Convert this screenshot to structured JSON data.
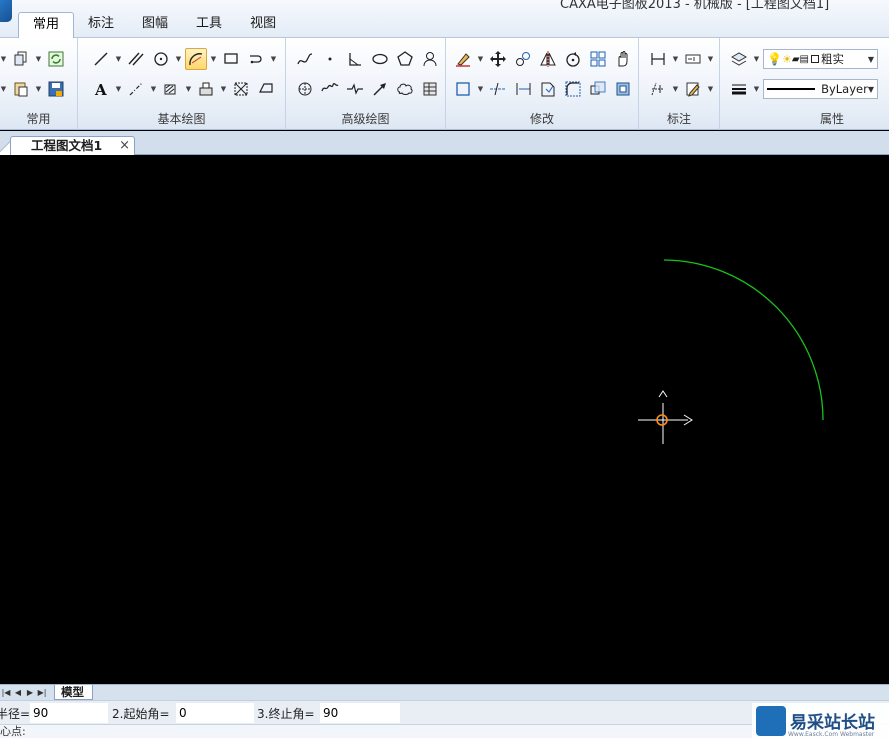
{
  "window": {
    "title": "CAXA电子图板2013 - 机械版 - [工程图文档1]"
  },
  "ribbon_tabs": [
    {
      "label": "常用",
      "active": true
    },
    {
      "label": "标注",
      "active": false
    },
    {
      "label": "图幅",
      "active": false
    },
    {
      "label": "工具",
      "active": false
    },
    {
      "label": "视图",
      "active": false
    }
  ],
  "groups": {
    "common": "常用",
    "basic_draw": "基本绘图",
    "advanced_draw": "高级绘图",
    "modify": "修改",
    "annotate": "标注",
    "properties": "属性"
  },
  "properties": {
    "linestyle_value": "粗实",
    "linetype_value": "ByLayer"
  },
  "document_tab": {
    "label": "工程图文档1",
    "close_glyph": "×"
  },
  "layout_tabs": {
    "model_label": "模型"
  },
  "command_line": {
    "param1_label": "半径=",
    "param1_value": "90",
    "param2_label": "2.起始角=",
    "param2_value": "0",
    "param3_label": "3.终止角=",
    "param3_value": "90",
    "prompt": "心点:"
  },
  "watermark": {
    "text": "易采站长站",
    "sub": "Www.Easck.Com Webmaster"
  },
  "colors": {
    "canvas_bg": "#000000",
    "arc": "#19c21e",
    "cursor": "#ffffff",
    "center_marker": "#ff8c1a",
    "ribbon_accent": "#ffd66b"
  },
  "icons": {
    "common_group": [
      "copy-icon",
      "refresh-icon",
      "paste-icon",
      "save-icon"
    ],
    "basic_draw_row1": [
      "line-icon",
      "parallel-line-icon",
      "circle-icon",
      "arc-icon",
      "rectangle-icon",
      "polyline-icon"
    ],
    "basic_draw_row2": [
      "text-icon",
      "centerline-icon",
      "hatch-icon",
      "block-icon",
      "region-icon",
      "boundary-icon"
    ],
    "advanced_draw_row1": [
      "spline-icon",
      "point-icon",
      "angle-line-icon",
      "ellipse-icon",
      "polygon-icon",
      "bolt-icon"
    ],
    "advanced_draw_row2": [
      "revolve-icon",
      "wave-icon",
      "break-line-icon",
      "arrow-icon",
      "cloud-icon",
      "table-icon"
    ],
    "modify_row1": [
      "erase-icon",
      "move-icon",
      "copy-object-icon",
      "mirror-icon",
      "rotate-icon",
      "array-icon",
      "pan-icon"
    ],
    "modify_row2": [
      "select-icon",
      "trim-icon",
      "extend-icon",
      "stretch-icon",
      "fillet-icon",
      "scale-icon",
      "explode-icon"
    ],
    "annotate_row1": [
      "dimension-icon",
      "ordinate-icon"
    ],
    "annotate_row2": [
      "tolerance-icon",
      "edit-annotation-icon"
    ]
  }
}
